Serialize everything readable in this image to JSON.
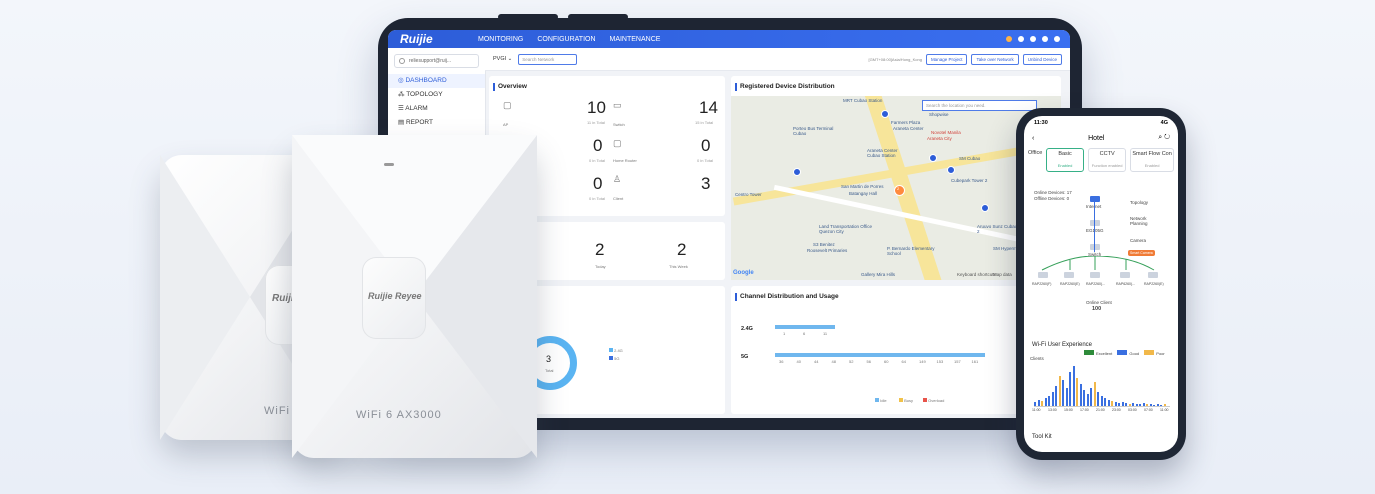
{
  "app": {
    "brand": "Ruijie",
    "top_nav": [
      "MONITORING",
      "CONFIGURATION",
      "MAINTENANCE"
    ]
  },
  "sidebar": {
    "user": "reliesupport@ruij...",
    "items": [
      {
        "label": "DASHBOARD",
        "active": true
      },
      {
        "label": "TOPOLOGY",
        "active": false
      },
      {
        "label": "ALARM",
        "active": false
      },
      {
        "label": "REPORT",
        "active": false
      }
    ]
  },
  "subbar": {
    "project": "PVGI",
    "search_placeholder": "Search Network",
    "breadcrumb": "[GMT+08:00]Asia/Hong_Kong",
    "buttons": [
      "Manage Project",
      "Take over Network",
      "Unbind Device"
    ]
  },
  "overview": {
    "title": "Overview",
    "stats": [
      {
        "value": "10",
        "sub": "11 in Total",
        "label": "AP"
      },
      {
        "value": "14",
        "sub": "15 in Total",
        "label": "Switch"
      },
      {
        "value": "0",
        "sub": "0 in Total",
        "label": ""
      },
      {
        "value": "0",
        "sub": "0 in Total",
        "label": "Home Router"
      },
      {
        "value": "0",
        "sub": "0 in Total",
        "label": ""
      },
      {
        "value": "3",
        "sub": "",
        "label": "Client"
      }
    ],
    "row2": [
      {
        "value": "2",
        "label": "red"
      },
      {
        "value": "2",
        "label": "Today"
      },
      {
        "value": "2",
        "label": "This Week"
      }
    ],
    "row2_zero": "0"
  },
  "registered": {
    "title": "Registered Device Distribution",
    "search_placeholder": "Search the location you need.",
    "labels": [
      "MRT Cubao Station",
      "Shopwise",
      "Farmers Plaza",
      "Araneta Center",
      "Novotel Manila",
      "Araneta City",
      "Porteo Bus Terminal Cubao",
      "Araneta Center Cubao Station",
      "SM Cubao",
      "Spark Place",
      "Cubepark Tower 2",
      "San Martin de Porres",
      "Batangay Hall",
      "Centro Tower",
      "Land Transportation Office Quezon City",
      "S3 Benitez",
      "Roosevelt Primaries",
      "P. Bernardo Elementary School",
      "Aruuvo Sunz Cubao Tower 2",
      "SM Hypermarket",
      "Gallery Mira Hills",
      "Keyboard shortcuts",
      "Map data",
      "Google"
    ],
    "cluster": "2"
  },
  "clients": {
    "title": "Clients",
    "total_value": "3",
    "total_label": "Total",
    "legend": [
      "2.4G",
      "5G"
    ]
  },
  "channel": {
    "title": "Channel Distribution and Usage",
    "bands": [
      "2.4G",
      "5G"
    ],
    "ch24": [
      "1",
      "6",
      "11"
    ],
    "ch5": [
      "36",
      "40",
      "44",
      "48",
      "52",
      "56",
      "60",
      "64",
      "149",
      "153",
      "157",
      "161"
    ],
    "legend": [
      "Idle",
      "Busy",
      "Overload"
    ]
  },
  "ap_devices": {
    "left_brand": "Ruijie",
    "left_wifi": "WiFi 6",
    "right_brand": "Ruijie Reyee",
    "right_wifi": "WiFi 6 AX3000"
  },
  "phone": {
    "time": "11:30",
    "signal": "4G",
    "title": "Hotel",
    "tabs": [
      {
        "label": "Office",
        "sub": ""
      },
      {
        "label": "Basic",
        "sub": "Enabled"
      },
      {
        "label": "CCTV",
        "sub": "Function enabled"
      },
      {
        "label": "Smart Flow Con",
        "sub": "Enabled"
      }
    ],
    "online_devices": "Online Devices: 17",
    "offline_devices": "Offline Devices: 0",
    "side_links": [
      "Topology",
      "Network Planning",
      "Camera",
      "Smart Camera"
    ],
    "nodes": [
      "Internet",
      "EG105G",
      "Switch"
    ],
    "aps": [
      "RAP2260(F)",
      "RAP2260(E)",
      "RAP2260(...",
      "RAP6260(...",
      "RAP2260(E)"
    ],
    "online_client_label": "Online Client",
    "online_client_value": "100",
    "wifi_title": "Wi-Fi User Experience",
    "wifi_legend": [
      "Excellent",
      "Good",
      "Poor"
    ],
    "clients_label": "Clients",
    "times": [
      "11:00",
      "13:00",
      "15:00",
      "17:00",
      "21:00",
      "23:00",
      "03:00",
      "07:00",
      "11:00"
    ],
    "toolkit": "Tool Kit"
  }
}
